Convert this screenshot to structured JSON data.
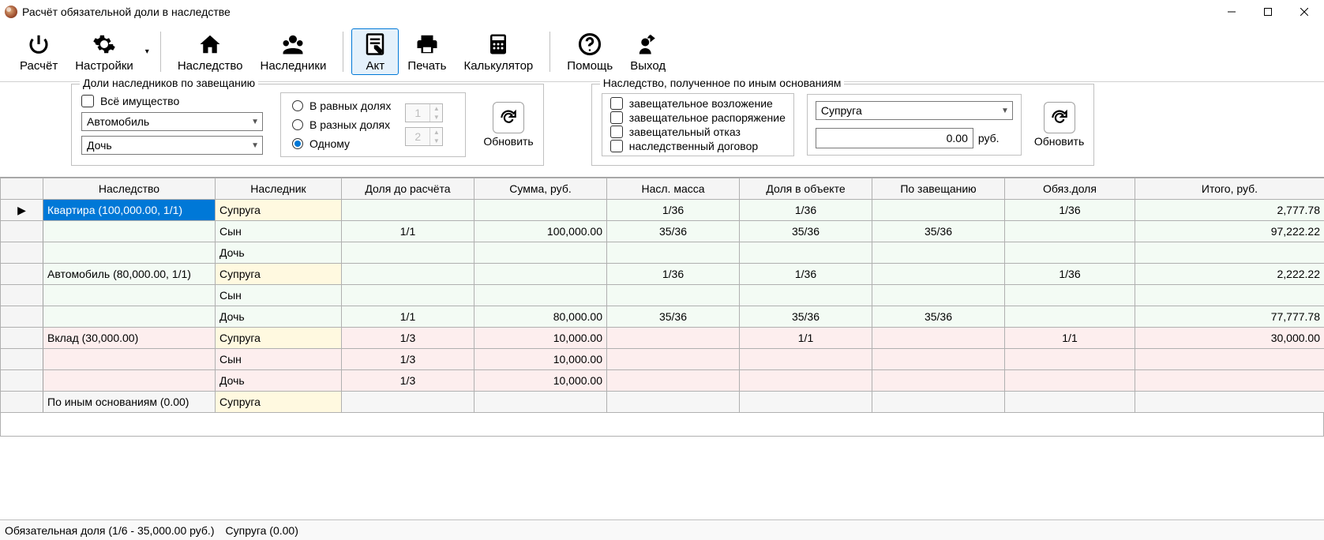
{
  "window": {
    "title": "Расчёт обязательной доли в наследстве"
  },
  "toolbar": {
    "calc": "Расчёт",
    "settings": "Настройки",
    "inheritance": "Наследство",
    "heirs": "Наследники",
    "act": "Акт",
    "print": "Печать",
    "calculator": "Калькулятор",
    "help": "Помощь",
    "exit": "Выход"
  },
  "panel1": {
    "title": "Доли наследников по завещанию",
    "all_property": "Всё имущество",
    "object_combo": "Автомобиль",
    "heir_combo": "Дочь",
    "equal": "В равных долях",
    "diff": "В разных долях",
    "one": "Одному",
    "spin1": "1",
    "spin2": "2",
    "refresh": "Обновить"
  },
  "panel2": {
    "title": "Наследство, полученное по иным основаниям",
    "cb1": "завещательное возложение",
    "cb2": "завещательное распоряжение",
    "cb3": "завещательный отказ",
    "cb4": "наследственный договор",
    "heir_combo": "Супруга",
    "amount": "0.00",
    "currency": "руб.",
    "refresh": "Обновить"
  },
  "table": {
    "headers": [
      "Наследство",
      "Наследник",
      "Доля до расчёта",
      "Сумма, руб.",
      "Насл. масса",
      "Доля в объекте",
      "По завещанию",
      "Обяз.доля",
      "Итого, руб."
    ],
    "rows": [
      {
        "cls": "r-green",
        "ptr": "▶",
        "c0": "Квартира (100,000.00, 1/1)",
        "c0cls": "c-sel",
        "c1": "Супруга",
        "c1cls": "c-yellow",
        "c2": "",
        "c3": "",
        "c4": "1/36",
        "c5": "1/36",
        "c6": "",
        "c7": "1/36",
        "c8": "2,777.78"
      },
      {
        "cls": "r-green",
        "ptr": "",
        "c0": "",
        "c1": "Сын",
        "c2": "1/1",
        "c3": "100,000.00",
        "c4": "35/36",
        "c5": "35/36",
        "c6": "35/36",
        "c7": "",
        "c8": "97,222.22"
      },
      {
        "cls": "r-green",
        "ptr": "",
        "c0": "",
        "c1": "Дочь",
        "c2": "",
        "c3": "",
        "c4": "",
        "c5": "",
        "c6": "",
        "c7": "",
        "c8": ""
      },
      {
        "cls": "r-green",
        "ptr": "",
        "c0": "Автомобиль (80,000.00, 1/1)",
        "c1": "Супруга",
        "c1cls": "c-yellow",
        "c2": "",
        "c3": "",
        "c4": "1/36",
        "c5": "1/36",
        "c6": "",
        "c7": "1/36",
        "c8": "2,222.22"
      },
      {
        "cls": "r-green",
        "ptr": "",
        "c0": "",
        "c1": "Сын",
        "c2": "",
        "c3": "",
        "c4": "",
        "c5": "",
        "c6": "",
        "c7": "",
        "c8": ""
      },
      {
        "cls": "r-green",
        "ptr": "",
        "c0": "",
        "c1": "Дочь",
        "c2": "1/1",
        "c3": "80,000.00",
        "c4": "35/36",
        "c5": "35/36",
        "c6": "35/36",
        "c7": "",
        "c8": "77,777.78"
      },
      {
        "cls": "r-pink",
        "ptr": "",
        "c0": "Вклад (30,000.00)",
        "c1": "Супруга",
        "c1cls": "c-yellow",
        "c2": "1/3",
        "c3": "10,000.00",
        "c4": "",
        "c5": "1/1",
        "c6": "",
        "c7": "1/1",
        "c8": "30,000.00"
      },
      {
        "cls": "r-pink",
        "ptr": "",
        "c0": "",
        "c1": "Сын",
        "c2": "1/3",
        "c3": "10,000.00",
        "c4": "",
        "c5": "",
        "c6": "",
        "c7": "",
        "c8": ""
      },
      {
        "cls": "r-pink",
        "ptr": "",
        "c0": "",
        "c1": "Дочь",
        "c2": "1/3",
        "c3": "10,000.00",
        "c4": "",
        "c5": "",
        "c6": "",
        "c7": "",
        "c8": ""
      },
      {
        "cls": "r-grey",
        "ptr": "",
        "c0": "По иным основаниям (0.00)",
        "c1": "Супруга",
        "c1cls": "c-yellow",
        "c2": "",
        "c3": "",
        "c4": "",
        "c5": "",
        "c6": "",
        "c7": "",
        "c8": ""
      }
    ]
  },
  "status": {
    "s1": "Обязательная доля (1/6 - 35,000.00 руб.)",
    "s2": "Супруга (0.00)"
  }
}
